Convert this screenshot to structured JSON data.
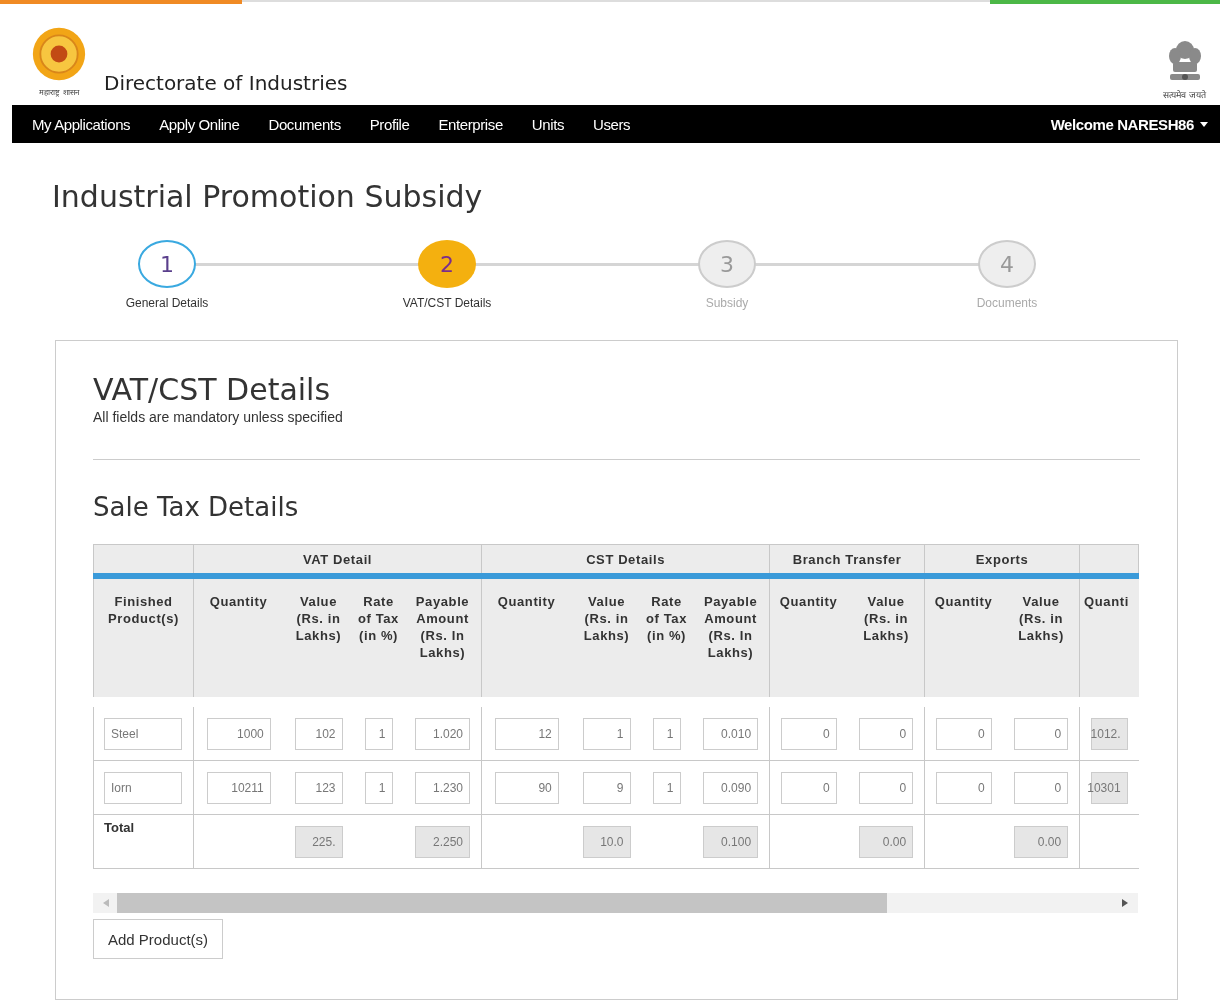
{
  "header": {
    "state_caption": "महाराष्ट्र शासन",
    "title": "Directorate of Industries",
    "emblem_caption": "सत्यमेव जयते"
  },
  "nav": {
    "items": [
      {
        "label": "My Applications"
      },
      {
        "label": "Apply Online"
      },
      {
        "label": "Documents"
      },
      {
        "label": "Profile"
      },
      {
        "label": "Enterprise"
      },
      {
        "label": "Units"
      },
      {
        "label": "Users"
      }
    ],
    "user_menu": "Welcome NARESH86"
  },
  "page_title": "Industrial Promotion Subsidy",
  "steps": [
    {
      "number": "1",
      "label": "General Details",
      "completed": true,
      "selected": false
    },
    {
      "number": "2",
      "label": "VAT/CST Details",
      "completed": false,
      "selected": true
    },
    {
      "number": "3",
      "label": "Subsidy",
      "completed": false,
      "selected": false
    },
    {
      "number": "4",
      "label": "Documents",
      "completed": false,
      "selected": false
    }
  ],
  "section": {
    "title": "VAT/CST Details",
    "subtitle": "All fields are mandatory unless specified"
  },
  "table_title": "Sale Tax Details",
  "table": {
    "groups": [
      {
        "label": "VAT Detail"
      },
      {
        "label": "CST Details"
      },
      {
        "label": "Branch Transfer"
      },
      {
        "label": "Exports"
      }
    ],
    "columns": [
      "Finished Product(s)",
      "Quantity",
      "Value (Rs. in Lakhs)",
      "Rate of Tax (in %)",
      "Payable Amount (Rs. In Lakhs)",
      "Quantity",
      "Value (Rs. in Lakhs)",
      "Rate of Tax (in %)",
      "Payable Amount (Rs. In Lakhs)",
      "Quantity",
      "Value (Rs. in Lakhs)",
      "Quantity",
      "Value (Rs. in Lakhs)",
      "Quanti"
    ],
    "rows": [
      [
        {
          "kind": "input",
          "value": "Steel"
        },
        {
          "kind": "input",
          "value": "1000"
        },
        {
          "kind": "input",
          "value": "102"
        },
        {
          "kind": "input",
          "value": "1"
        },
        {
          "kind": "input",
          "value": "1.020"
        },
        {
          "kind": "input",
          "value": "12"
        },
        {
          "kind": "input",
          "value": "1"
        },
        {
          "kind": "input",
          "value": "1"
        },
        {
          "kind": "input",
          "value": "0.010"
        },
        {
          "kind": "input",
          "value": "0"
        },
        {
          "kind": "input",
          "value": "0"
        },
        {
          "kind": "input",
          "value": "0"
        },
        {
          "kind": "input",
          "value": "0"
        },
        {
          "kind": "readonly",
          "value": "1012."
        }
      ],
      [
        {
          "kind": "input",
          "value": "Iorn"
        },
        {
          "kind": "input",
          "value": "10211"
        },
        {
          "kind": "input",
          "value": "123"
        },
        {
          "kind": "input",
          "value": "1"
        },
        {
          "kind": "input",
          "value": "1.230"
        },
        {
          "kind": "input",
          "value": "90"
        },
        {
          "kind": "input",
          "value": "9"
        },
        {
          "kind": "input",
          "value": "1"
        },
        {
          "kind": "input",
          "value": "0.090"
        },
        {
          "kind": "input",
          "value": "0"
        },
        {
          "kind": "input",
          "value": "0"
        },
        {
          "kind": "input",
          "value": "0"
        },
        {
          "kind": "input",
          "value": "0"
        },
        {
          "kind": "readonly",
          "value": "10301"
        }
      ],
      [
        {
          "kind": "text",
          "value": "Total"
        },
        {
          "kind": "empty"
        },
        {
          "kind": "readonly",
          "value": "225."
        },
        {
          "kind": "empty"
        },
        {
          "kind": "readonly",
          "value": "2.250"
        },
        {
          "kind": "empty"
        },
        {
          "kind": "readonly",
          "value": "10.0"
        },
        {
          "kind": "empty"
        },
        {
          "kind": "readonly",
          "value": "0.100"
        },
        {
          "kind": "empty"
        },
        {
          "kind": "readonly",
          "value": "0.00"
        },
        {
          "kind": "empty"
        },
        {
          "kind": "readonly",
          "value": "0.00"
        },
        {
          "kind": "empty"
        }
      ]
    ]
  },
  "add_button": "Add Product(s)"
}
